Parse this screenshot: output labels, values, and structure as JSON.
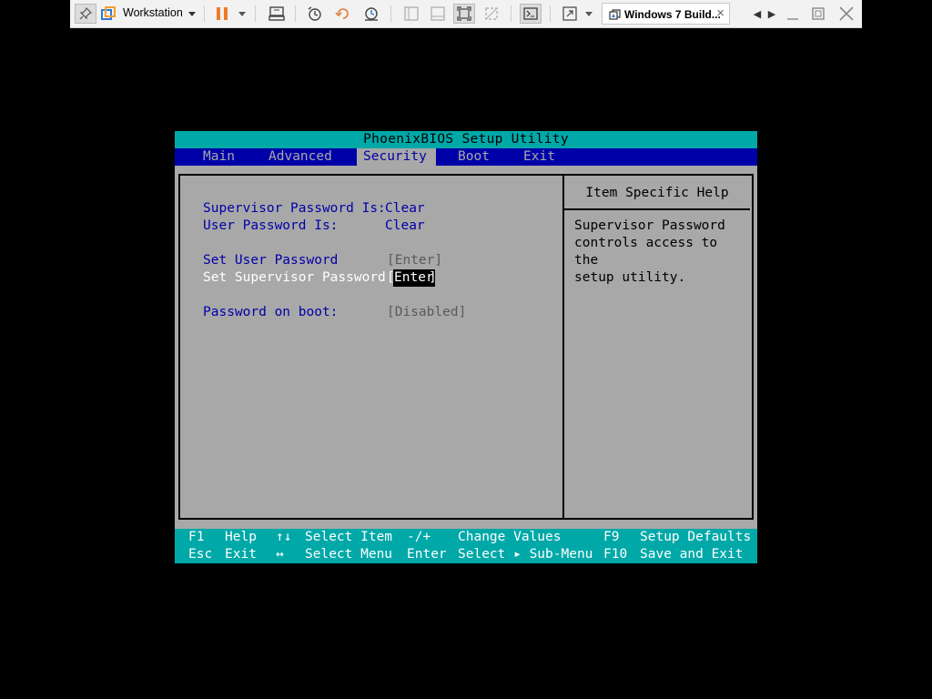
{
  "toolbar": {
    "workstation_label": "Workstation",
    "vm_tab_title": "Windows 7 Build...",
    "close_glyph": "×",
    "nav_prev": "◀",
    "nav_next": "▶",
    "accent_color": "#2d7bd4",
    "pause_color": "#f07a2a"
  },
  "bios": {
    "title": "PhoenixBIOS Setup Utility",
    "menu": [
      "Main",
      "Advanced",
      "Security",
      "Boot",
      "Exit"
    ],
    "active_menu": "Security",
    "options": {
      "supervisor_status_label": "Supervisor Password Is:",
      "supervisor_status_value": "Clear",
      "user_status_label": "User Password Is:",
      "user_status_value": "Clear",
      "set_user_label": "Set User Password",
      "set_user_value": "[Enter]",
      "set_supervisor_label": "Set Supervisor Password",
      "set_supervisor_bracket_open": "[",
      "set_supervisor_value": "Enter",
      "set_supervisor_bracket_close": "]",
      "password_on_boot_label": "Password on boot:",
      "password_on_boot_value": "[Disabled]"
    },
    "help": {
      "title": "Item Specific Help",
      "text": "Supervisor Password\ncontrols access to the\nsetup utility."
    },
    "footer": {
      "row1": [
        {
          "key": "F1",
          "desc": "Help"
        },
        {
          "key": "↑↓",
          "desc": "Select Item"
        },
        {
          "key": "-/+",
          "desc": "Change Values"
        },
        {
          "key": "F9",
          "desc": "Setup Defaults"
        }
      ],
      "row2": [
        {
          "key": "Esc",
          "desc": "Exit"
        },
        {
          "key": "↔",
          "desc": "Select Menu"
        },
        {
          "key": "Enter",
          "desc": "Select ▸ Sub-Menu"
        },
        {
          "key": "F10",
          "desc": "Save and Exit"
        }
      ]
    },
    "colors": {
      "title_bg": "#00a8a8",
      "menu_bg": "#0000a8",
      "body_bg": "#a8a8a8",
      "option_text": "#0000a8",
      "selected_text": "#ffffff"
    }
  }
}
